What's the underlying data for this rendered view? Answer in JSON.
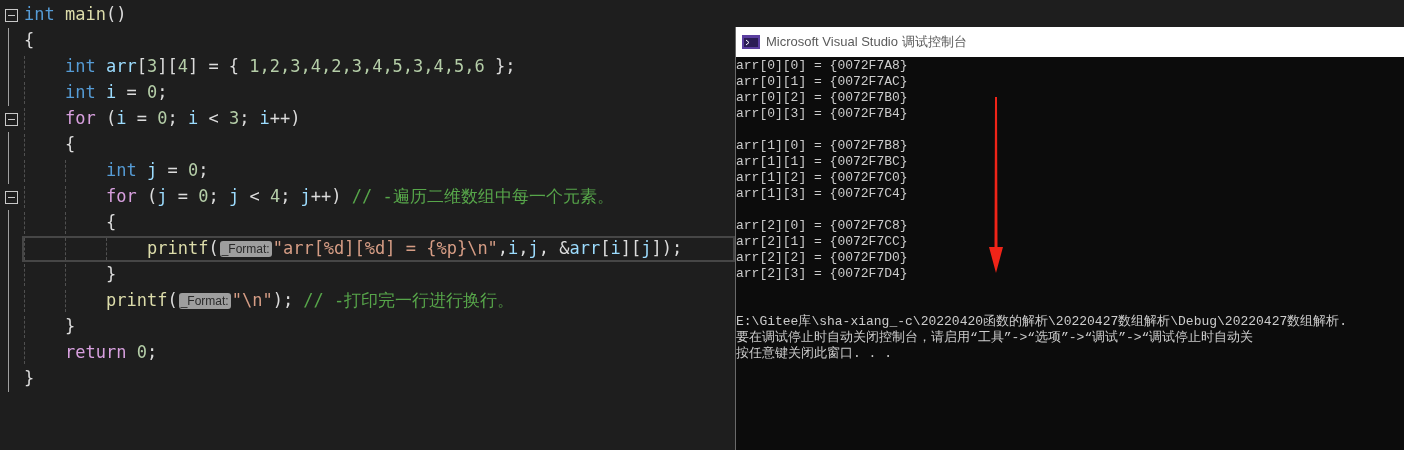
{
  "editor": {
    "lines": [
      {
        "collapsible": true,
        "current": false,
        "tokens": [
          {
            "kind": "type",
            "text": "int"
          },
          {
            "kind": "func",
            "text": " main"
          },
          {
            "kind": "punct",
            "text": "()"
          }
        ]
      },
      {
        "collapsible": false,
        "current": false,
        "tokens": [
          {
            "kind": "punct",
            "text": "{"
          }
        ],
        "children": [
          {
            "collapsible": false,
            "current": false,
            "tokens": [
              {
                "kind": "type",
                "text": "int"
              },
              {
                "kind": "ident",
                "text": " arr"
              },
              {
                "kind": "punct",
                "text": "["
              },
              {
                "kind": "number",
                "text": "3"
              },
              {
                "kind": "punct",
                "text": "]["
              },
              {
                "kind": "number",
                "text": "4"
              },
              {
                "kind": "punct",
                "text": "] = { "
              },
              {
                "kind": "number",
                "text": "1,2,3,4,2,3,4,5,3,4,5,6"
              },
              {
                "kind": "punct",
                "text": " };"
              }
            ]
          },
          {
            "collapsible": false,
            "current": false,
            "tokens": [
              {
                "kind": "type",
                "text": "int"
              },
              {
                "kind": "ident",
                "text": " i"
              },
              {
                "kind": "punct",
                "text": " = "
              },
              {
                "kind": "number",
                "text": "0"
              },
              {
                "kind": "punct",
                "text": ";"
              }
            ]
          },
          {
            "collapsible": true,
            "current": false,
            "tokens": [
              {
                "kind": "keyword",
                "text": "for"
              },
              {
                "kind": "punct",
                "text": " ("
              },
              {
                "kind": "ident",
                "text": "i"
              },
              {
                "kind": "punct",
                "text": " = "
              },
              {
                "kind": "number",
                "text": "0"
              },
              {
                "kind": "punct",
                "text": "; "
              },
              {
                "kind": "ident",
                "text": "i"
              },
              {
                "kind": "punct",
                "text": " < "
              },
              {
                "kind": "number",
                "text": "3"
              },
              {
                "kind": "punct",
                "text": "; "
              },
              {
                "kind": "ident",
                "text": "i"
              },
              {
                "kind": "punct",
                "text": "++)"
              }
            ]
          },
          {
            "collapsible": false,
            "current": false,
            "tokens": [
              {
                "kind": "punct",
                "text": "{"
              }
            ],
            "children": [
              {
                "collapsible": false,
                "current": false,
                "tokens": [
                  {
                    "kind": "type",
                    "text": "int"
                  },
                  {
                    "kind": "ident",
                    "text": " j"
                  },
                  {
                    "kind": "punct",
                    "text": " = "
                  },
                  {
                    "kind": "number",
                    "text": "0"
                  },
                  {
                    "kind": "punct",
                    "text": ";"
                  }
                ]
              },
              {
                "collapsible": true,
                "current": false,
                "tokens": [
                  {
                    "kind": "keyword",
                    "text": "for"
                  },
                  {
                    "kind": "punct",
                    "text": " ("
                  },
                  {
                    "kind": "ident",
                    "text": "j"
                  },
                  {
                    "kind": "punct",
                    "text": " = "
                  },
                  {
                    "kind": "number",
                    "text": "0"
                  },
                  {
                    "kind": "punct",
                    "text": "; "
                  },
                  {
                    "kind": "ident",
                    "text": "j"
                  },
                  {
                    "kind": "punct",
                    "text": " < "
                  },
                  {
                    "kind": "number",
                    "text": "4"
                  },
                  {
                    "kind": "punct",
                    "text": "; "
                  },
                  {
                    "kind": "ident",
                    "text": "j"
                  },
                  {
                    "kind": "punct",
                    "text": "++) "
                  },
                  {
                    "kind": "comment",
                    "text": "// -遍历二维数组中每一个元素。"
                  }
                ]
              },
              {
                "collapsible": false,
                "current": false,
                "tokens": [
                  {
                    "kind": "punct",
                    "text": "{"
                  }
                ],
                "children": [
                  {
                    "collapsible": false,
                    "current": true,
                    "tokens": [
                      {
                        "kind": "func",
                        "text": "printf"
                      },
                      {
                        "kind": "punct",
                        "text": "("
                      },
                      {
                        "kind": "hint",
                        "text": "_Format:"
                      },
                      {
                        "kind": "string",
                        "text": "\"arr[%d][%d] = {%p}\\n\""
                      },
                      {
                        "kind": "punct",
                        "text": ","
                      },
                      {
                        "kind": "ident",
                        "text": "i"
                      },
                      {
                        "kind": "punct",
                        "text": ","
                      },
                      {
                        "kind": "ident",
                        "text": "j"
                      },
                      {
                        "kind": "punct",
                        "text": ", &"
                      },
                      {
                        "kind": "ident",
                        "text": "arr"
                      },
                      {
                        "kind": "punct",
                        "text": "["
                      },
                      {
                        "kind": "ident",
                        "text": "i"
                      },
                      {
                        "kind": "punct",
                        "text": "]["
                      },
                      {
                        "kind": "ident",
                        "text": "j"
                      },
                      {
                        "kind": "punct",
                        "text": "]);"
                      }
                    ]
                  }
                ]
              },
              {
                "collapsible": false,
                "current": false,
                "tokens": [
                  {
                    "kind": "punct",
                    "text": "}"
                  }
                ]
              },
              {
                "collapsible": false,
                "current": false,
                "tokens": [
                  {
                    "kind": "func",
                    "text": "printf"
                  },
                  {
                    "kind": "punct",
                    "text": "("
                  },
                  {
                    "kind": "hint",
                    "text": "_Format:"
                  },
                  {
                    "kind": "string",
                    "text": "\"\\n\""
                  },
                  {
                    "kind": "punct",
                    "text": "); "
                  },
                  {
                    "kind": "comment",
                    "text": "// -打印完一行进行换行。"
                  }
                ]
              }
            ]
          },
          {
            "collapsible": false,
            "current": false,
            "tokens": [
              {
                "kind": "punct",
                "text": "}"
              }
            ]
          },
          {
            "collapsible": false,
            "current": false,
            "tokens": [
              {
                "kind": "keyword",
                "text": "return"
              },
              {
                "kind": "number",
                "text": " 0"
              },
              {
                "kind": "punct",
                "text": ";"
              }
            ]
          }
        ]
      },
      {
        "collapsible": false,
        "current": false,
        "tokens": [
          {
            "kind": "punct",
            "text": "}"
          }
        ]
      }
    ]
  },
  "console": {
    "title": "Microsoft Visual Studio 调试控制台",
    "blocks": [
      {
        "kind": "values",
        "lines": [
          "arr[0][0] = {0072F7A8}",
          "arr[0][1] = {0072F7AC}",
          "arr[0][2] = {0072F7B0}",
          "arr[0][3] = {0072F7B4}"
        ]
      },
      {
        "kind": "values",
        "lines": [
          "arr[1][0] = {0072F7B8}",
          "arr[1][1] = {0072F7BC}",
          "arr[1][2] = {0072F7C0}",
          "arr[1][3] = {0072F7C4}"
        ]
      },
      {
        "kind": "values",
        "lines": [
          "arr[2][0] = {0072F7C8}",
          "arr[2][1] = {0072F7CC}",
          "arr[2][2] = {0072F7D0}",
          "arr[2][3] = {0072F7D4}"
        ]
      },
      {
        "kind": "message",
        "lines": [
          "E:\\Gitee库\\sha-xiang_-c\\20220420函数的解析\\20220427数组解析\\Debug\\20220427数组解析.",
          "要在调试停止时自动关闭控制台，请启用“工具”->“选项”->“调试”->“调试停止时自动关",
          "按任意键关闭此窗口. . ."
        ]
      }
    ]
  }
}
